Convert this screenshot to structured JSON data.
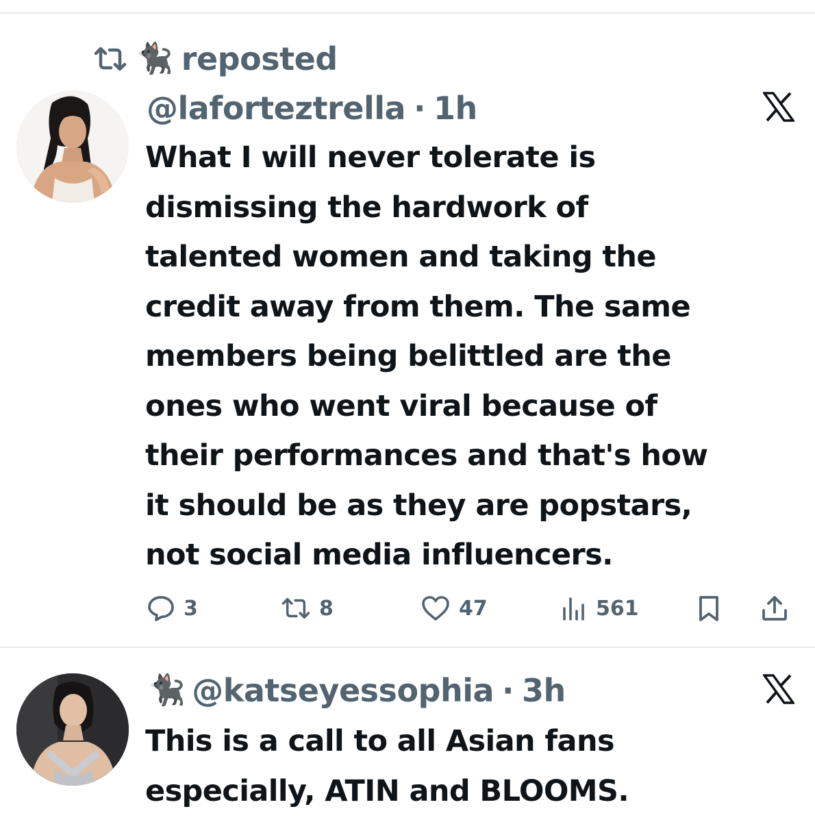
{
  "feed": {
    "repost_banner": {
      "icon": "repost-icon",
      "emoji": "🐈‍⬛",
      "label": "reposted"
    },
    "posts": [
      {
        "handle": "@laforteztrella",
        "separator": "·",
        "time": "1h",
        "platform_icon": "x-logo-icon",
        "text": "What I will never tolerate is\ndismissing the hardwork of\ntalented women and taking the\ncredit away from them. The same\nmembers being belittled are the\nones who went viral because of\ntheir performances and that's how\nit should be as they are popstars,\nnot social media influencers.",
        "actions": {
          "replies": "3",
          "reposts": "8",
          "likes": "47",
          "views": "561"
        }
      },
      {
        "emoji": "🐈‍⬛",
        "handle": "@katseyessophia",
        "separator": "·",
        "time": "3h",
        "platform_icon": "x-logo-icon",
        "text": "This is a call to all Asian fans\nespecially, ATIN and BLOOMS."
      }
    ]
  }
}
